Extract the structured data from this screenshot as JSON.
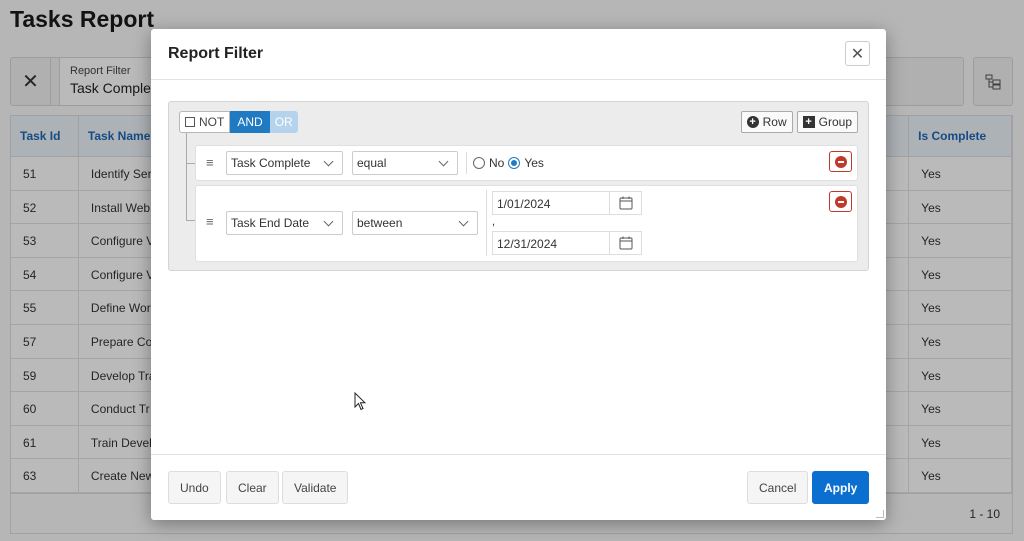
{
  "page": {
    "title": "Tasks Report",
    "filter_chip": {
      "label": "Report Filter",
      "value": "Task Complete"
    },
    "clear_icon": "close-icon",
    "tree_icon": "hierarchy-icon",
    "grid": {
      "headers": [
        "Task Id",
        "Task Name",
        "Is Complete"
      ],
      "rows": [
        {
          "id": "51",
          "name": "Identify Ser",
          "complete": "Yes"
        },
        {
          "id": "52",
          "name": "Install Web",
          "complete": "Yes"
        },
        {
          "id": "53",
          "name": "Configure V",
          "complete": "Yes"
        },
        {
          "id": "54",
          "name": "Configure V",
          "complete": "Yes"
        },
        {
          "id": "55",
          "name": "Define Wor",
          "complete": "Yes"
        },
        {
          "id": "57",
          "name": "Prepare Co",
          "complete": "Yes"
        },
        {
          "id": "59",
          "name": "Develop Tra",
          "complete": "Yes"
        },
        {
          "id": "60",
          "name": "Conduct Tr",
          "complete": "Yes"
        },
        {
          "id": "61",
          "name": "Train Devel",
          "complete": "Yes"
        },
        {
          "id": "63",
          "name": "Create New",
          "complete": "Yes"
        }
      ],
      "pagination": "1 - 10"
    }
  },
  "dialog": {
    "title": "Report Filter",
    "close_icon": "close-icon",
    "group": {
      "not_label": "NOT",
      "and_label": "AND",
      "or_label": "OR",
      "add_row_label": "Row",
      "add_group_label": "Group"
    },
    "rules": [
      {
        "field": "Task Complete",
        "operator": "equal",
        "options": [
          "No",
          "Yes"
        ],
        "selected": "Yes"
      },
      {
        "field": "Task End Date",
        "operator": "between",
        "value_from": "1/01/2024",
        "separator": ",",
        "value_to": "12/31/2024"
      }
    ],
    "footer": {
      "undo": "Undo",
      "clear": "Clear",
      "validate": "Validate",
      "cancel": "Cancel",
      "apply": "Apply"
    }
  },
  "colors": {
    "accent": "#0b6fd0",
    "and_active": "#1f7ac1",
    "or_inactive": "#b5d3ec",
    "delete": "#c0392b",
    "header_text": "#2167b6"
  }
}
